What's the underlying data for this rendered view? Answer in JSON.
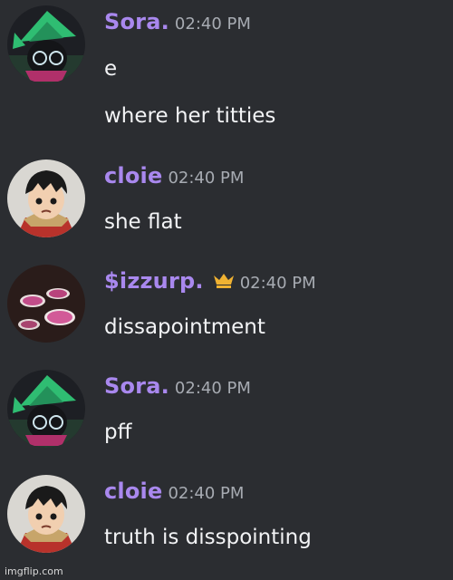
{
  "messages": [
    {
      "user": "Sora.",
      "time": "02:40 PM",
      "lines": [
        "e",
        "where her titties"
      ],
      "avatar_icon": "green-hat-character-avatar"
    },
    {
      "user": "cloie",
      "time": "02:40 PM",
      "lines": [
        "she flat"
      ],
      "avatar_icon": "anime-straw-hat-boy-avatar"
    },
    {
      "user": "$izzurp.",
      "time": "02:40 PM",
      "lines": [
        "dissapointment"
      ],
      "avatar_icon": "purple-drink-cups-avatar",
      "badge_icon": "crown-icon"
    },
    {
      "user": "Sora.",
      "time": "02:40 PM",
      "lines": [
        "pff"
      ],
      "avatar_icon": "green-hat-character-avatar"
    },
    {
      "user": "cloie",
      "time": "02:40 PM",
      "lines": [
        "truth is disspointing"
      ],
      "avatar_icon": "anime-straw-hat-boy-avatar"
    }
  ],
  "watermark": "imgflip.com",
  "colors": {
    "background": "#2b2d31",
    "username": "#a988ee",
    "timestamp": "#a7abb2",
    "message_text": "#f2f3f5",
    "crown": "#f0b232"
  }
}
